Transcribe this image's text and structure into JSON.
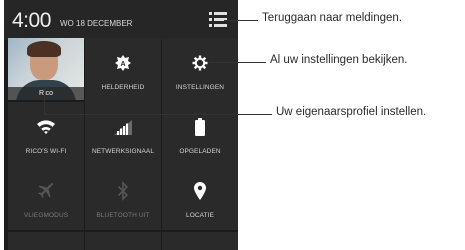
{
  "status": {
    "time": "4:00",
    "date": "WO 18 DECEMBER"
  },
  "profile": {
    "name": "Rico"
  },
  "tiles": [
    {
      "label": "HELDERHEID",
      "icon": "brightness-auto-icon",
      "state": "on"
    },
    {
      "label": "INSTELLINGEN",
      "icon": "gear-icon",
      "state": "on"
    },
    {
      "label": "RICO'S WI-FI",
      "icon": "wifi-icon",
      "state": "on"
    },
    {
      "label": "NETWERKSIGNAAL",
      "icon": "signal-icon",
      "state": "on"
    },
    {
      "label": "OPGELADEN",
      "icon": "battery-full-icon",
      "state": "on"
    },
    {
      "label": "VLIEGMODUS",
      "icon": "airplane-icon",
      "state": "off"
    },
    {
      "label": "BLUETOOTH UIT",
      "icon": "bluetooth-icon",
      "state": "off"
    },
    {
      "label": "LOCATIE",
      "icon": "location-pin-icon",
      "state": "on"
    }
  ],
  "callouts": {
    "notifications": "Teruggaan naar meldingen.",
    "settings": "Al uw instellingen bekijken.",
    "profile": "Uw eigenaarsprofiel instellen."
  },
  "colors": {
    "panel_bg": "#1b1b1b",
    "tile_bg": "#2a2a2a",
    "icon_on": "#ffffff",
    "icon_off": "#5a5a5a"
  }
}
